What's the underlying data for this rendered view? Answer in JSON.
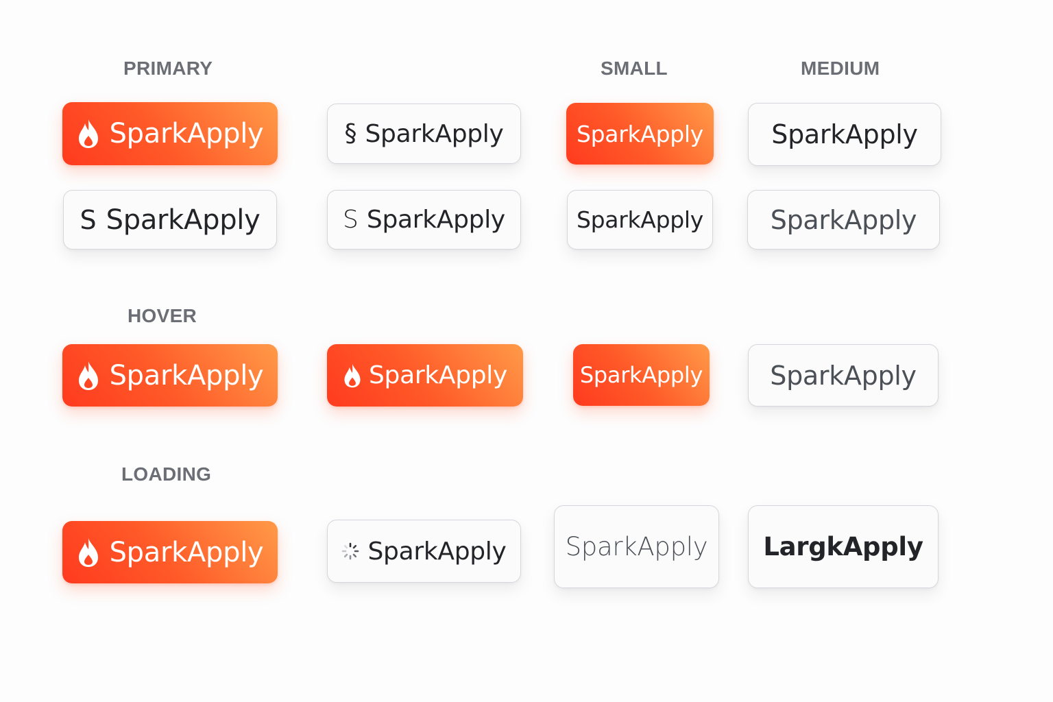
{
  "section_labels": {
    "primary": "PRIMARY",
    "small": "SMALL",
    "medium": "MEDIUM",
    "hover": "HOVER",
    "loading": "LOADING"
  },
  "brand": "SparkApply",
  "brand_typo": "LargkApply",
  "icon_glyphs": {
    "s_letter": "S",
    "s_stylized": "§"
  },
  "icons": [
    "flame-icon",
    "s-logo-icon",
    "spinner-icon"
  ],
  "colors": {
    "primary_start": "#ff3a1f",
    "primary_mid": "#ff5a28",
    "primary_end": "#ff9a48",
    "secondary_bg": "#fbfbfc",
    "secondary_border": "#d4d7dc",
    "text_dark": "#222428",
    "label_gray": "#6b6e74"
  }
}
